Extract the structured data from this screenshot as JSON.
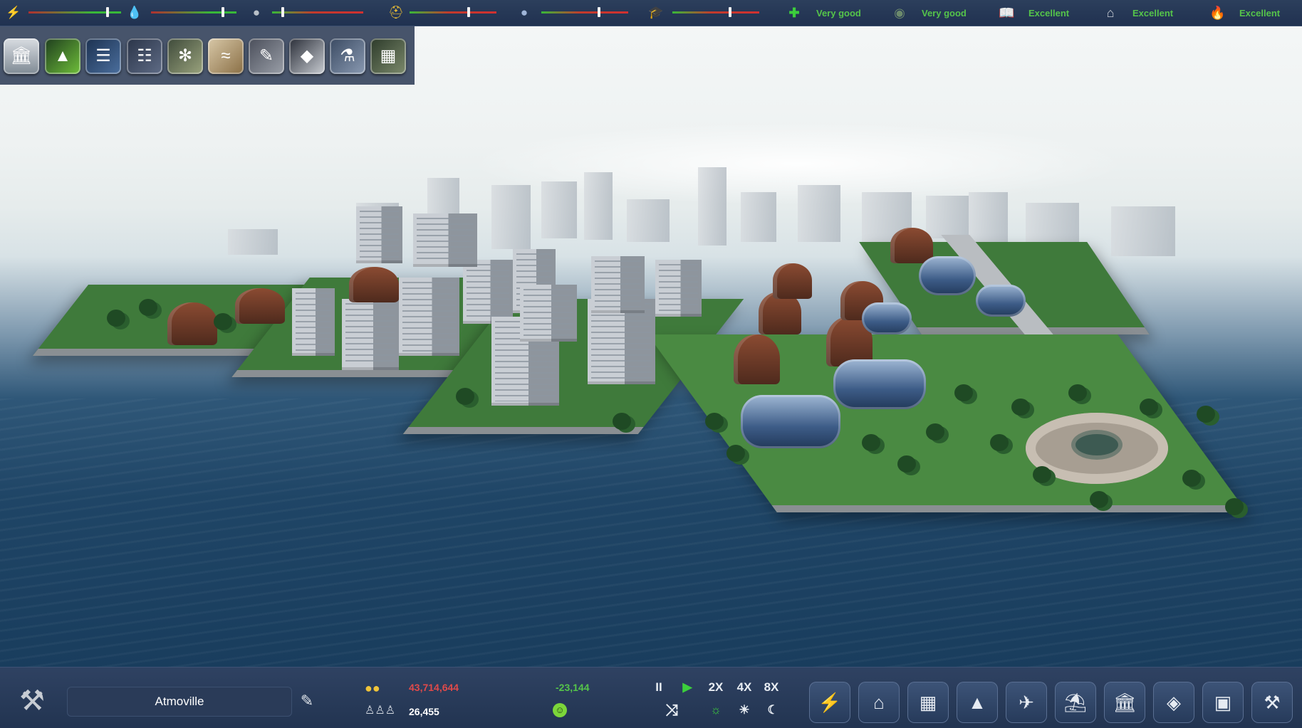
{
  "top_hud": {
    "indicators": [
      {
        "name": "power",
        "icon": "lightning-icon",
        "level": 0.85
      },
      {
        "name": "water",
        "icon": "water-drop-icon",
        "level": 0.84
      },
      {
        "name": "waste",
        "icon": "garbage-bag-icon",
        "level": 0.12
      },
      {
        "name": "industry",
        "icon": "hard-hat-icon",
        "level": 0.68
      },
      {
        "name": "police",
        "icon": "police-cap-icon",
        "level": 0.66
      },
      {
        "name": "education",
        "icon": "graduation-cap-icon",
        "level": 0.66
      }
    ],
    "ratings": [
      {
        "name": "health",
        "icon": "health-cross-icon",
        "label": "Very good"
      },
      {
        "name": "safety",
        "icon": "mask-icon",
        "label": "Very good"
      },
      {
        "name": "culture",
        "icon": "book-icon",
        "label": "Excellent"
      },
      {
        "name": "housing",
        "icon": "house-icon",
        "label": "Excellent"
      },
      {
        "name": "fire",
        "icon": "fire-hydrant-icon",
        "label": "Excellent"
      }
    ],
    "colors": {
      "rating_text": "#55c44a",
      "bar_good": "#38b838",
      "bar_bad": "#d03030"
    }
  },
  "tool_strip": {
    "tools": [
      {
        "icon": "city-view-icon"
      },
      {
        "icon": "terrain-icon"
      },
      {
        "icon": "roads-icon"
      },
      {
        "icon": "rail-icon"
      },
      {
        "icon": "finance-icon"
      },
      {
        "icon": "graph-icon"
      },
      {
        "icon": "document-icon"
      },
      {
        "icon": "map-icon"
      },
      {
        "icon": "research-flask-icon"
      },
      {
        "icon": "library-icon"
      }
    ]
  },
  "bottom_hud": {
    "city_name": "Atmoville",
    "money": "43,714,644",
    "money_delta": "-23,144",
    "population": "26,455",
    "happiness_icon": "smiley-icon",
    "colors": {
      "money": "#e04a4a",
      "money_delta": "#55c44a",
      "population": "#ffffff"
    },
    "speed": {
      "pause": "II",
      "speed_2x": "2X",
      "speed_4x": "4X",
      "speed_8x": "8X"
    },
    "build_menu": [
      {
        "icon": "power-plant-icon"
      },
      {
        "icon": "residential-icon"
      },
      {
        "icon": "commercial-icon"
      },
      {
        "icon": "industrial-icon"
      },
      {
        "icon": "transport-icon"
      },
      {
        "icon": "services-icon"
      },
      {
        "icon": "government-icon"
      },
      {
        "icon": "landmark-icon"
      },
      {
        "icon": "warehouse-icon"
      },
      {
        "icon": "bulldozer-icon"
      }
    ]
  }
}
